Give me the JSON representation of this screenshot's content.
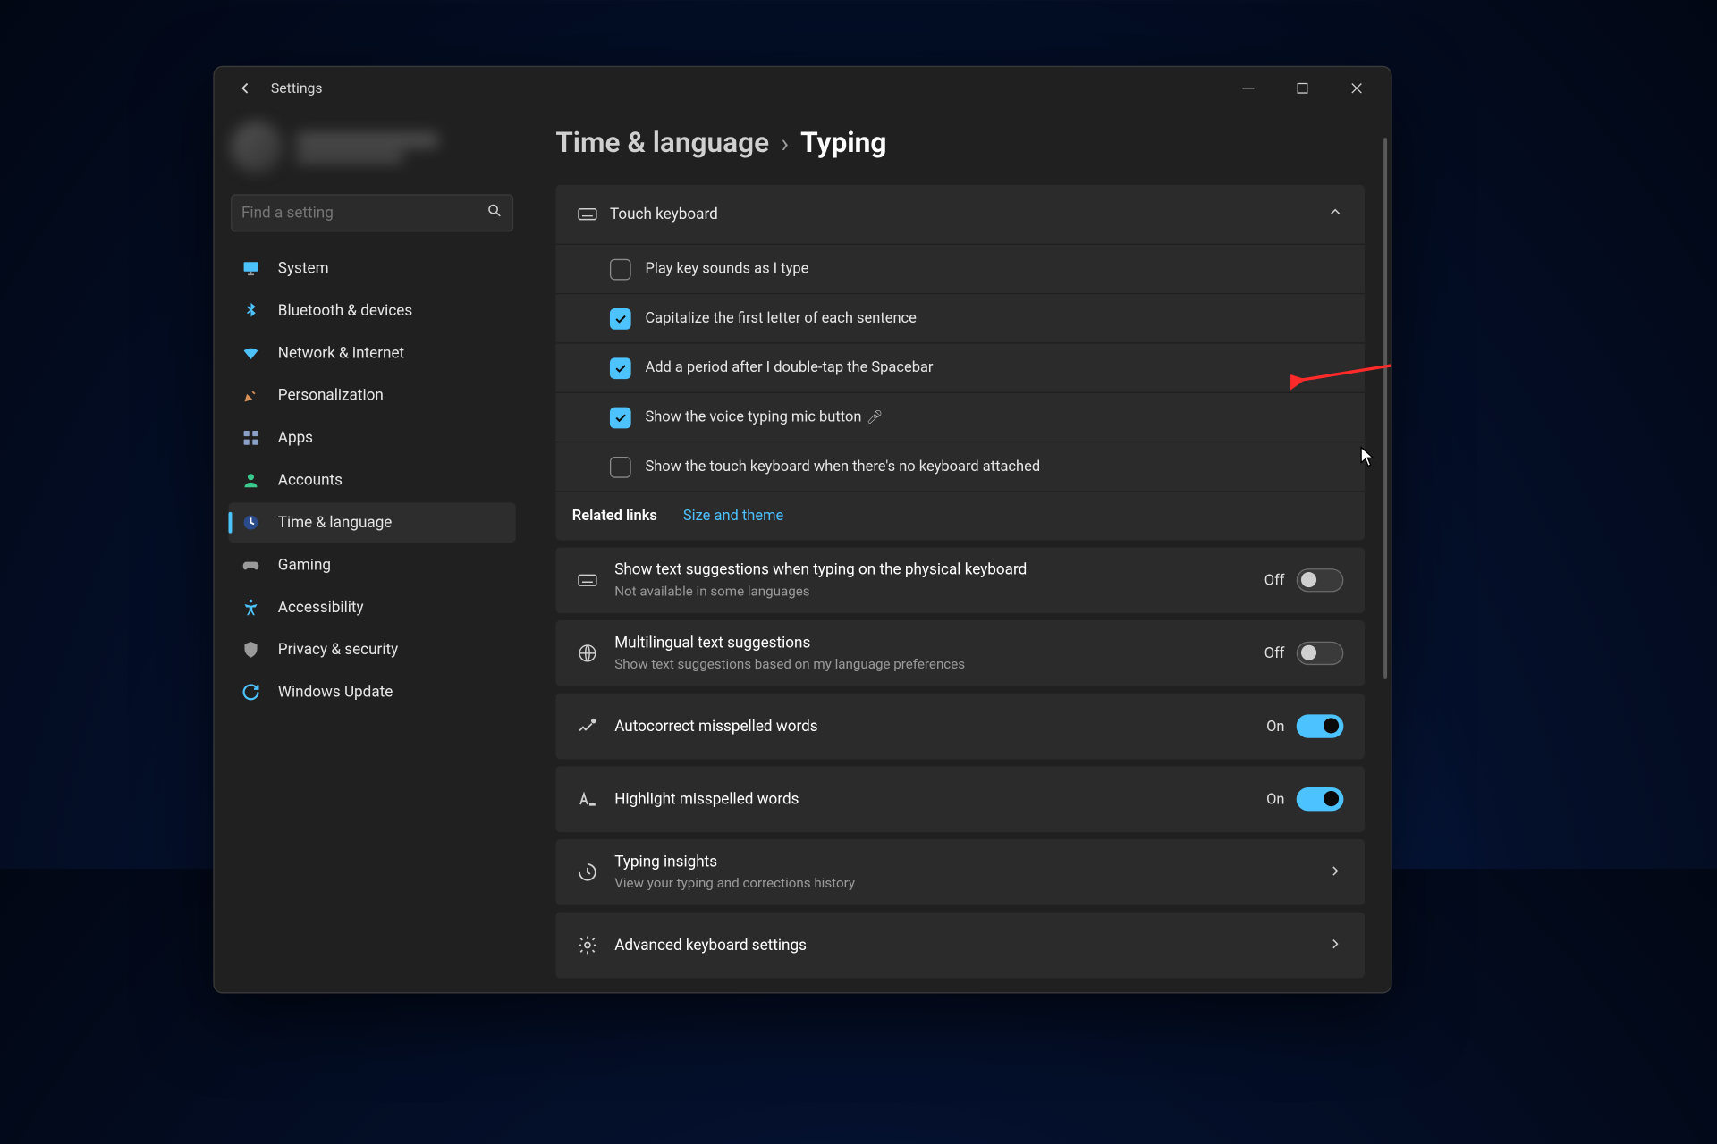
{
  "window": {
    "title": "Settings"
  },
  "search": {
    "placeholder": "Find a setting"
  },
  "sidebar": {
    "items": [
      {
        "id": "system",
        "label": "System"
      },
      {
        "id": "bluetooth",
        "label": "Bluetooth & devices"
      },
      {
        "id": "network",
        "label": "Network & internet"
      },
      {
        "id": "personalization",
        "label": "Personalization"
      },
      {
        "id": "apps",
        "label": "Apps"
      },
      {
        "id": "accounts",
        "label": "Accounts"
      },
      {
        "id": "time-language",
        "label": "Time & language"
      },
      {
        "id": "gaming",
        "label": "Gaming"
      },
      {
        "id": "accessibility",
        "label": "Accessibility"
      },
      {
        "id": "privacy",
        "label": "Privacy & security"
      },
      {
        "id": "update",
        "label": "Windows Update"
      }
    ],
    "activeIndex": 6
  },
  "breadcrumb": {
    "parent": "Time & language",
    "current": "Typing"
  },
  "touchKeyboard": {
    "title": "Touch keyboard",
    "options": [
      {
        "label": "Play key sounds as I type",
        "checked": false
      },
      {
        "label": "Capitalize the first letter of each sentence",
        "checked": true
      },
      {
        "label": "Add a period after I double-tap the Spacebar",
        "checked": true
      },
      {
        "label": "Show the voice typing mic button",
        "checked": true,
        "mic": true
      },
      {
        "label": "Show the touch keyboard when there's no keyboard attached",
        "checked": false
      }
    ],
    "related": {
      "label": "Related links",
      "link": "Size and theme"
    }
  },
  "rows": [
    {
      "id": "text-suggestions",
      "title": "Show text suggestions when typing on the physical keyboard",
      "sub": "Not available in some languages",
      "kind": "toggle",
      "on": false
    },
    {
      "id": "multilingual",
      "title": "Multilingual text suggestions",
      "sub": "Show text suggestions based on my language preferences",
      "kind": "toggle",
      "on": false
    },
    {
      "id": "autocorrect",
      "title": "Autocorrect misspelled words",
      "kind": "toggle",
      "on": true
    },
    {
      "id": "highlight",
      "title": "Highlight misspelled words",
      "kind": "toggle",
      "on": true
    },
    {
      "id": "insights",
      "title": "Typing insights",
      "sub": "View your typing and corrections history",
      "kind": "nav"
    },
    {
      "id": "advanced",
      "title": "Advanced keyboard settings",
      "kind": "nav"
    }
  ],
  "toggleText": {
    "on": "On",
    "off": "Off"
  }
}
